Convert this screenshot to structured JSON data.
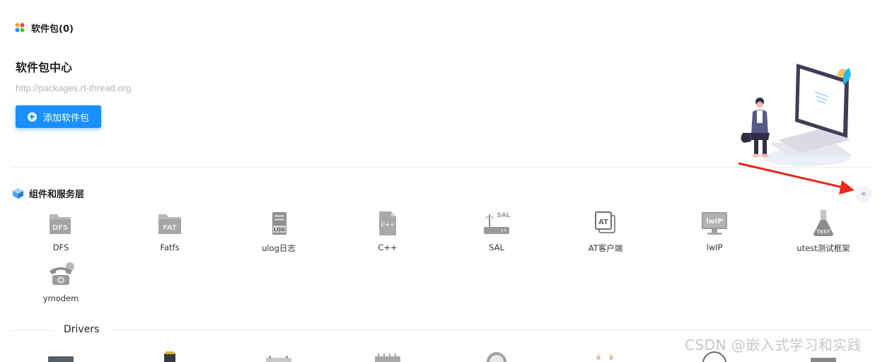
{
  "header": {
    "packages_title": "软件包(0)",
    "center_title": "软件包中心",
    "center_url": "http://packages.rt-thread.org",
    "add_button_label": "添加软件包"
  },
  "components_section": {
    "title": "组件和服务层",
    "collapse_glyph": "«",
    "items": [
      {
        "label": "DFS",
        "icon": "dfs-folder-icon"
      },
      {
        "label": "Fatfs",
        "icon": "fat-folder-icon"
      },
      {
        "label": "ulog日志",
        "icon": "log-file-icon"
      },
      {
        "label": "C++",
        "icon": "cpp-file-icon"
      },
      {
        "label": "SAL",
        "icon": "sal-router-icon"
      },
      {
        "label": "AT客户端",
        "icon": "at-stack-icon"
      },
      {
        "label": "lwIP",
        "icon": "lwip-monitor-icon"
      },
      {
        "label": "utest测试框架",
        "icon": "test-flask-icon"
      },
      {
        "label": "ymodem",
        "icon": "telephone-icon"
      }
    ]
  },
  "drivers_section": {
    "title": "Drivers"
  },
  "watermark": "CSDN @嵌入式学习和实践",
  "colors": {
    "accent": "#1890ff",
    "arrow": "#e8291c",
    "icon_gray": "#9a9a9a"
  }
}
